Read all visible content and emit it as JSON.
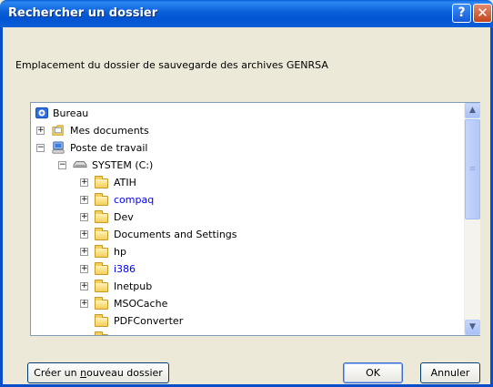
{
  "window": {
    "title": "Rechercher un dossier",
    "help_glyph": "?",
    "close_glyph": "✕"
  },
  "instruction": "Emplacement du dossier de sauvegarde des archives GENRSA",
  "tree": {
    "items": [
      {
        "label": "Bureau",
        "icon": "desktop-icon",
        "expander": "",
        "color": "#000000"
      },
      {
        "label": "Mes documents",
        "icon": "my-documents-icon",
        "expander": "+",
        "color": "#000000"
      },
      {
        "label": "Poste de travail",
        "icon": "my-computer-icon",
        "expander": "−",
        "color": "#000000"
      },
      {
        "label": "SYSTEM (C:)",
        "icon": "drive-icon",
        "expander": "−",
        "color": "#000000"
      },
      {
        "label": "ATIH",
        "icon": "folder-icon",
        "expander": "+",
        "color": "#000000"
      },
      {
        "label": "compaq",
        "icon": "folder-icon",
        "expander": "+",
        "color": "#0000ff"
      },
      {
        "label": "Dev",
        "icon": "folder-icon",
        "expander": "+",
        "color": "#000000"
      },
      {
        "label": "Documents and Settings",
        "icon": "folder-icon",
        "expander": "+",
        "color": "#000000"
      },
      {
        "label": "hp",
        "icon": "folder-icon",
        "expander": "+",
        "color": "#000000"
      },
      {
        "label": "i386",
        "icon": "folder-icon",
        "expander": "+",
        "color": "#0000ff"
      },
      {
        "label": "Inetpub",
        "icon": "folder-icon",
        "expander": "+",
        "color": "#000000"
      },
      {
        "label": "MSOCache",
        "icon": "folder-icon",
        "expander": "+",
        "color": "#000000"
      },
      {
        "label": "PDFConverter",
        "icon": "folder-icon",
        "expander": "",
        "color": "#000000"
      }
    ]
  },
  "buttons": {
    "new_folder_pre": "Créer un ",
    "new_folder_u": "n",
    "new_folder_post": "ouveau dossier",
    "ok": "OK",
    "cancel": "Annuler"
  }
}
